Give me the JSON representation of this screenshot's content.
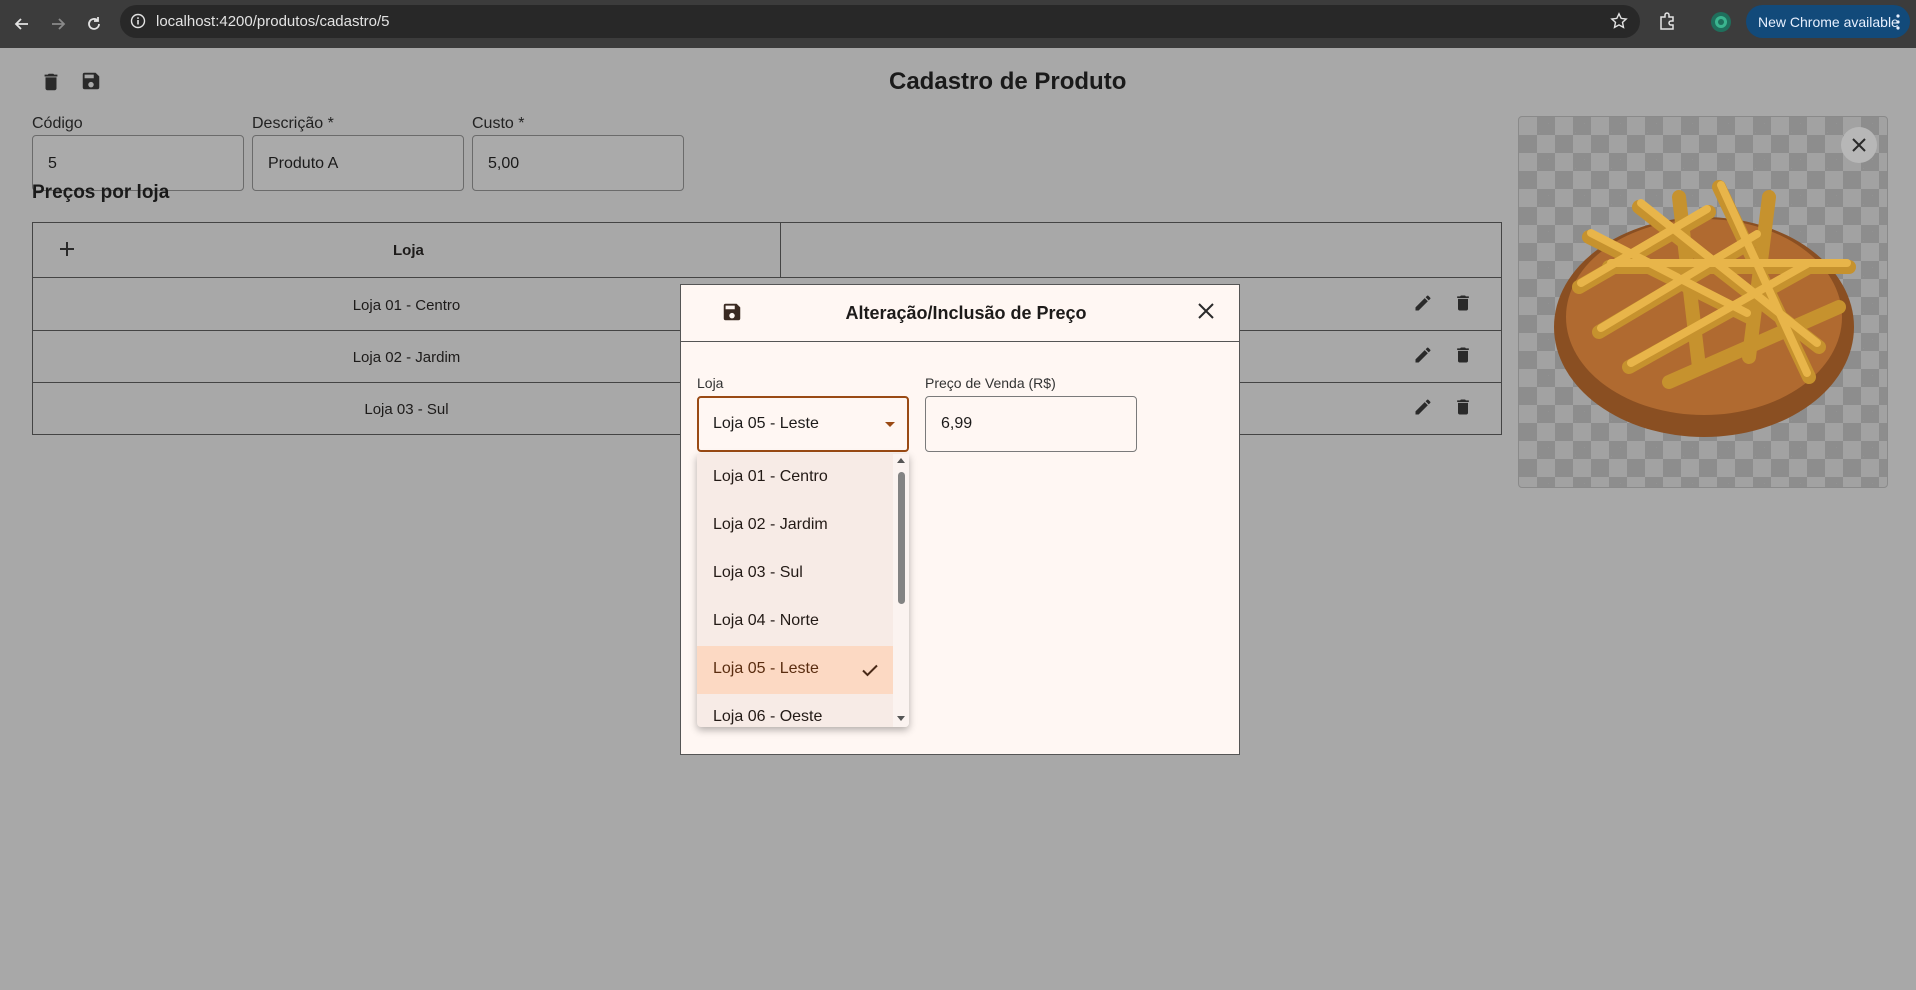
{
  "browser": {
    "url": "localhost:4200/produtos/cadastro/5",
    "update_label": "New Chrome available"
  },
  "page": {
    "title": "Cadastro de Produto",
    "fields": {
      "codigo": {
        "label": "Código",
        "value": "5"
      },
      "descricao": {
        "label": "Descrição *",
        "value": "Produto A"
      },
      "custo": {
        "label": "Custo *",
        "value": "5,00"
      }
    },
    "section_title": "Preços por loja",
    "table": {
      "header_loja": "Loja",
      "rows": [
        {
          "loja": "Loja 01 - Centro"
        },
        {
          "loja": "Loja 02 - Jardim"
        },
        {
          "loja": "Loja 03 - Sul"
        }
      ]
    }
  },
  "dialog": {
    "title": "Alteração/Inclusão de Preço",
    "loja_label": "Loja",
    "loja_value": "Loja 05 - Leste",
    "preco_label": "Preço de Venda (R$)",
    "preco_value": "6,99",
    "options": [
      "Loja 01 - Centro",
      "Loja 02 - Jardim",
      "Loja 03 - Sul",
      "Loja 04 - Norte",
      "Loja 05 - Leste",
      "Loja 06 - Oeste"
    ],
    "selected_option": "Loja 05 - Leste"
  },
  "colors": {
    "accent": "#9a4a14",
    "selected_option_bg": "#fcd9c3",
    "overlay": "#a8a8a8"
  }
}
